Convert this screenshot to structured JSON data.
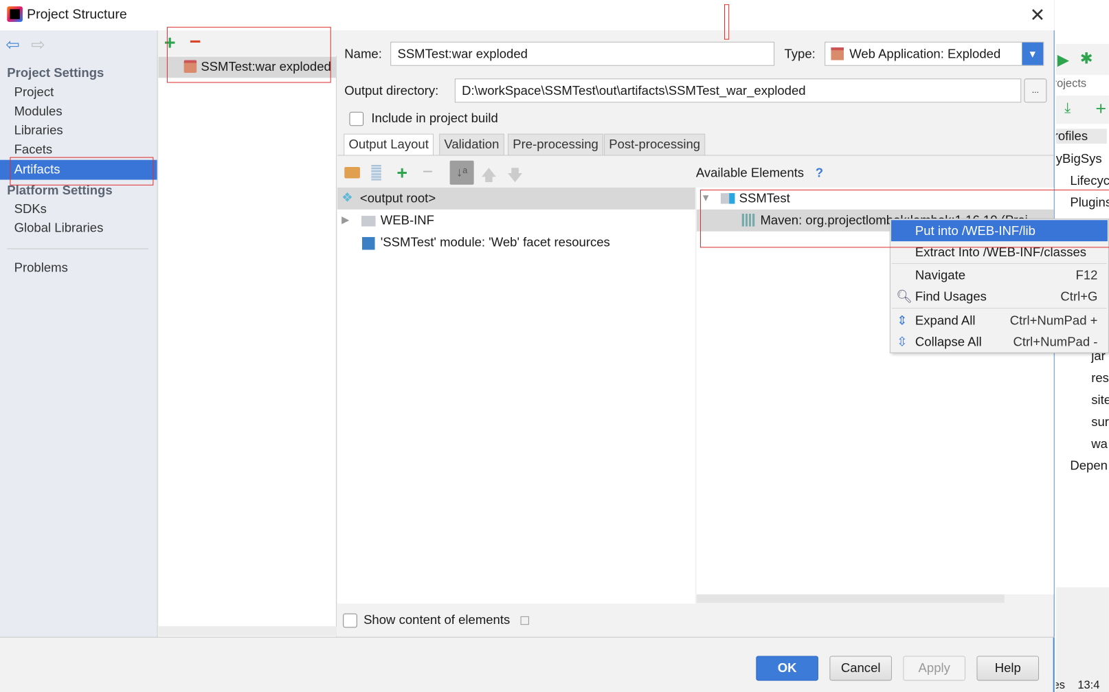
{
  "window": {
    "title": "Project Structure",
    "close_icon": "close-icon"
  },
  "sidebar": {
    "sections": [
      {
        "heading": "Project Settings",
        "items": [
          "Project",
          "Modules",
          "Libraries",
          "Facets",
          "Artifacts"
        ]
      },
      {
        "heading": "Platform Settings",
        "items": [
          "SDKs",
          "Global Libraries"
        ]
      }
    ],
    "extra": "Problems",
    "selected": "Artifacts"
  },
  "artifacts": {
    "items": [
      {
        "label": "SSMTest:war exploded",
        "icon": "war-artifact-icon"
      }
    ]
  },
  "form": {
    "name_label": "Name:",
    "name_value": "SSMTest:war exploded",
    "type_label": "Type:",
    "type_value": "Web Application: Exploded",
    "output_label": "Output directory:",
    "output_value": "D:\\workSpace\\SSMTest\\out\\artifacts\\SSMTest_war_exploded",
    "browse_label": "...",
    "include_label": "Include in project build",
    "include_checked": false
  },
  "tabs": [
    {
      "label": "Output Layout",
      "active": true
    },
    {
      "label": "Validation"
    },
    {
      "label": "Pre-processing"
    },
    {
      "label": "Post-processing"
    }
  ],
  "layout_tree": [
    {
      "label": "<output root>",
      "selected": true
    },
    {
      "label": "WEB-INF",
      "expandable": true
    },
    {
      "label": "'SSMTest' module: 'Web' facet resources"
    }
  ],
  "available": {
    "heading": "Available Elements",
    "help": "?",
    "tree": [
      {
        "label": "SSMTest",
        "expanded": true
      },
      {
        "label": "Maven: org.projectlombok:lombok:1.16.10 (Proj"
      }
    ]
  },
  "context_menu": {
    "items": [
      {
        "label": "Put into /WEB-INF/lib",
        "highlighted": true
      },
      {
        "label": "Extract Into /WEB-INF/classes"
      },
      {
        "label": "Navigate",
        "shortcut": "F12"
      },
      {
        "label": "Find Usages",
        "shortcut": "Ctrl+G"
      },
      {
        "label": "Expand All",
        "shortcut": "Ctrl+NumPad +"
      },
      {
        "label": "Collapse All",
        "shortcut": "Ctrl+NumPad -"
      }
    ]
  },
  "show_content_label": "Show content of elements",
  "buttons": {
    "ok": "OK",
    "cancel": "Cancel",
    "apply": "Apply",
    "help": "Help"
  },
  "ide_background": {
    "items": [
      "rojects",
      "rofiles",
      "lyBigSys",
      "Lifecyc",
      "Plugins",
      "jar",
      "res",
      "site",
      "sur",
      "wa",
      "Depen"
    ],
    "status": "es    13:4"
  },
  "colors": {
    "accent": "#3d7bd9",
    "selection": "#3875d7",
    "highlight_box": "#e03030"
  }
}
